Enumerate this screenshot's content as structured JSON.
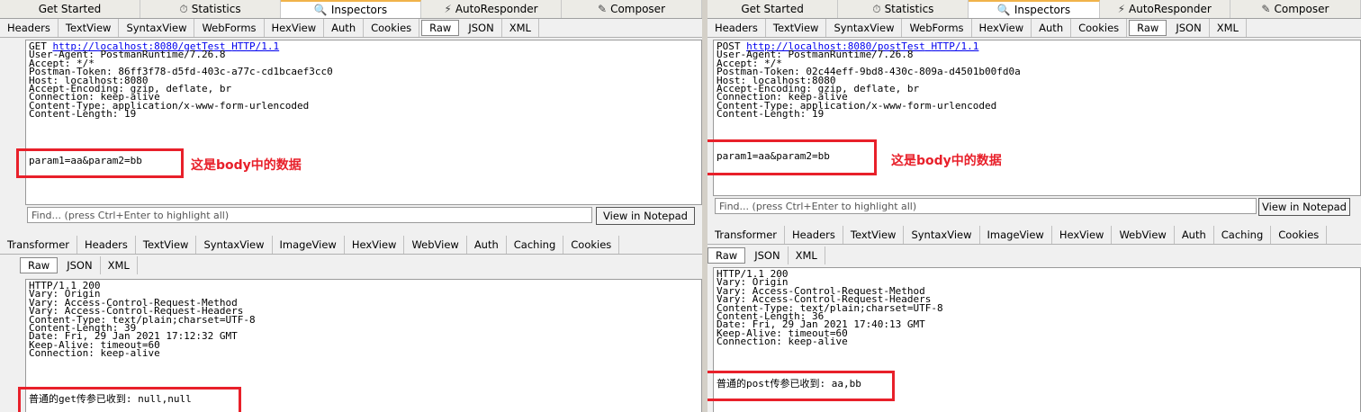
{
  "top_tabs": [
    {
      "label": "Get Started",
      "icon": "none"
    },
    {
      "label": "Statistics",
      "icon": "stopwatch-icon"
    },
    {
      "label": "Inspectors",
      "icon": "magnifier-icon"
    },
    {
      "label": "AutoResponder",
      "icon": "lightning-icon"
    },
    {
      "label": "Composer",
      "icon": "compose-icon"
    }
  ],
  "request_tabs": [
    "Headers",
    "TextView",
    "SyntaxView",
    "WebForms",
    "HexView",
    "Auth",
    "Cookies",
    "Raw",
    "JSON",
    "XML"
  ],
  "response_tabs": [
    "Transformer",
    "Headers",
    "TextView",
    "SyntaxView",
    "ImageView",
    "HexView",
    "WebView",
    "Auth",
    "Caching",
    "Cookies"
  ],
  "response_subtabs": [
    "Raw",
    "JSON",
    "XML"
  ],
  "find_placeholder": "Find... (press Ctrl+Enter to highlight all)",
  "view_in_notepad": "View in Notepad",
  "annotation_note": "这是body中的数据",
  "left": {
    "request_method": "GET",
    "request_url": "http://localhost:8080/getTest",
    "request_protocol": "HTTP/1.1",
    "request_headers": [
      "User-Agent: PostmanRuntime/7.26.8",
      "Accept: */*",
      "Postman-Token: 86ff3f78-d5fd-403c-a77c-cd1bcaef3cc0",
      "Host: localhost:8080",
      "Accept-Encoding: gzip, deflate, br",
      "Connection: keep-alive",
      "Content-Type: application/x-www-form-urlencoded",
      "Content-Length: 19"
    ],
    "request_body": "param1=aa&param2=bb",
    "response_headers": [
      "HTTP/1.1 200",
      "Vary: Origin",
      "Vary: Access-Control-Request-Method",
      "Vary: Access-Control-Request-Headers",
      "Content-Type: text/plain;charset=UTF-8",
      "Content-Length: 39",
      "Date: Fri, 29 Jan 2021 17:12:32 GMT",
      "Keep-Alive: timeout=60",
      "Connection: keep-alive"
    ],
    "response_body": "普通的get传参已收到: null,null"
  },
  "right": {
    "request_method": "POST",
    "request_url": "http://localhost:8080/postTest",
    "request_protocol": "HTTP/1.1",
    "request_headers": [
      "User-Agent: PostmanRuntime/7.26.8",
      "Accept: */*",
      "Postman-Token: 02c44eff-9bd8-430c-809a-d4501b00fd0a",
      "Host: localhost:8080",
      "Accept-Encoding: gzip, deflate, br",
      "Connection: keep-alive",
      "Content-Type: application/x-www-form-urlencoded",
      "Content-Length: 19"
    ],
    "request_body": "param1=aa&param2=bb",
    "response_headers": [
      "HTTP/1.1 200",
      "Vary: Origin",
      "Vary: Access-Control-Request-Method",
      "Vary: Access-Control-Request-Headers",
      "Content-Type: text/plain;charset=UTF-8",
      "Content-Length: 36",
      "Date: Fri, 29 Jan 2021 17:40:13 GMT",
      "Keep-Alive: timeout=60",
      "Connection: keep-alive"
    ],
    "response_body": "普通的post传参已收到: aa,bb"
  },
  "colors": {
    "annotation_red": "#e8202a",
    "active_tab_accent": "#f0b34a",
    "url_blue": "#0000ee"
  }
}
